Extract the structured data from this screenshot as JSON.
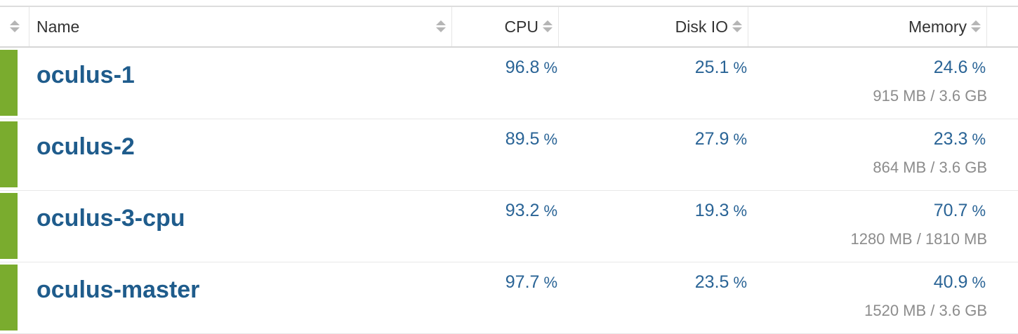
{
  "header": {
    "name_label": "Name",
    "cpu_label": "CPU",
    "disk_label": "Disk IO",
    "memory_label": "Memory"
  },
  "colors": {
    "status_ok": "#7aac2e",
    "link": "#1f5c8c",
    "value": "#2a6496",
    "muted": "#8c8c8c"
  },
  "percent_sign": "%",
  "rows": [
    {
      "name": "oculus-1",
      "cpu": "96.8",
      "disk": "25.1",
      "memory": "24.6",
      "memory_detail": "915 MB / 3.6 GB",
      "status": "ok"
    },
    {
      "name": "oculus-2",
      "cpu": "89.5",
      "disk": "27.9",
      "memory": "23.3",
      "memory_detail": "864 MB / 3.6 GB",
      "status": "ok"
    },
    {
      "name": "oculus-3-cpu",
      "cpu": "93.2",
      "disk": "19.3",
      "memory": "70.7",
      "memory_detail": "1280 MB / 1810 MB",
      "status": "ok"
    },
    {
      "name": "oculus-master",
      "cpu": "97.7",
      "disk": "23.5",
      "memory": "40.9",
      "memory_detail": "1520 MB / 3.6 GB",
      "status": "ok"
    }
  ]
}
